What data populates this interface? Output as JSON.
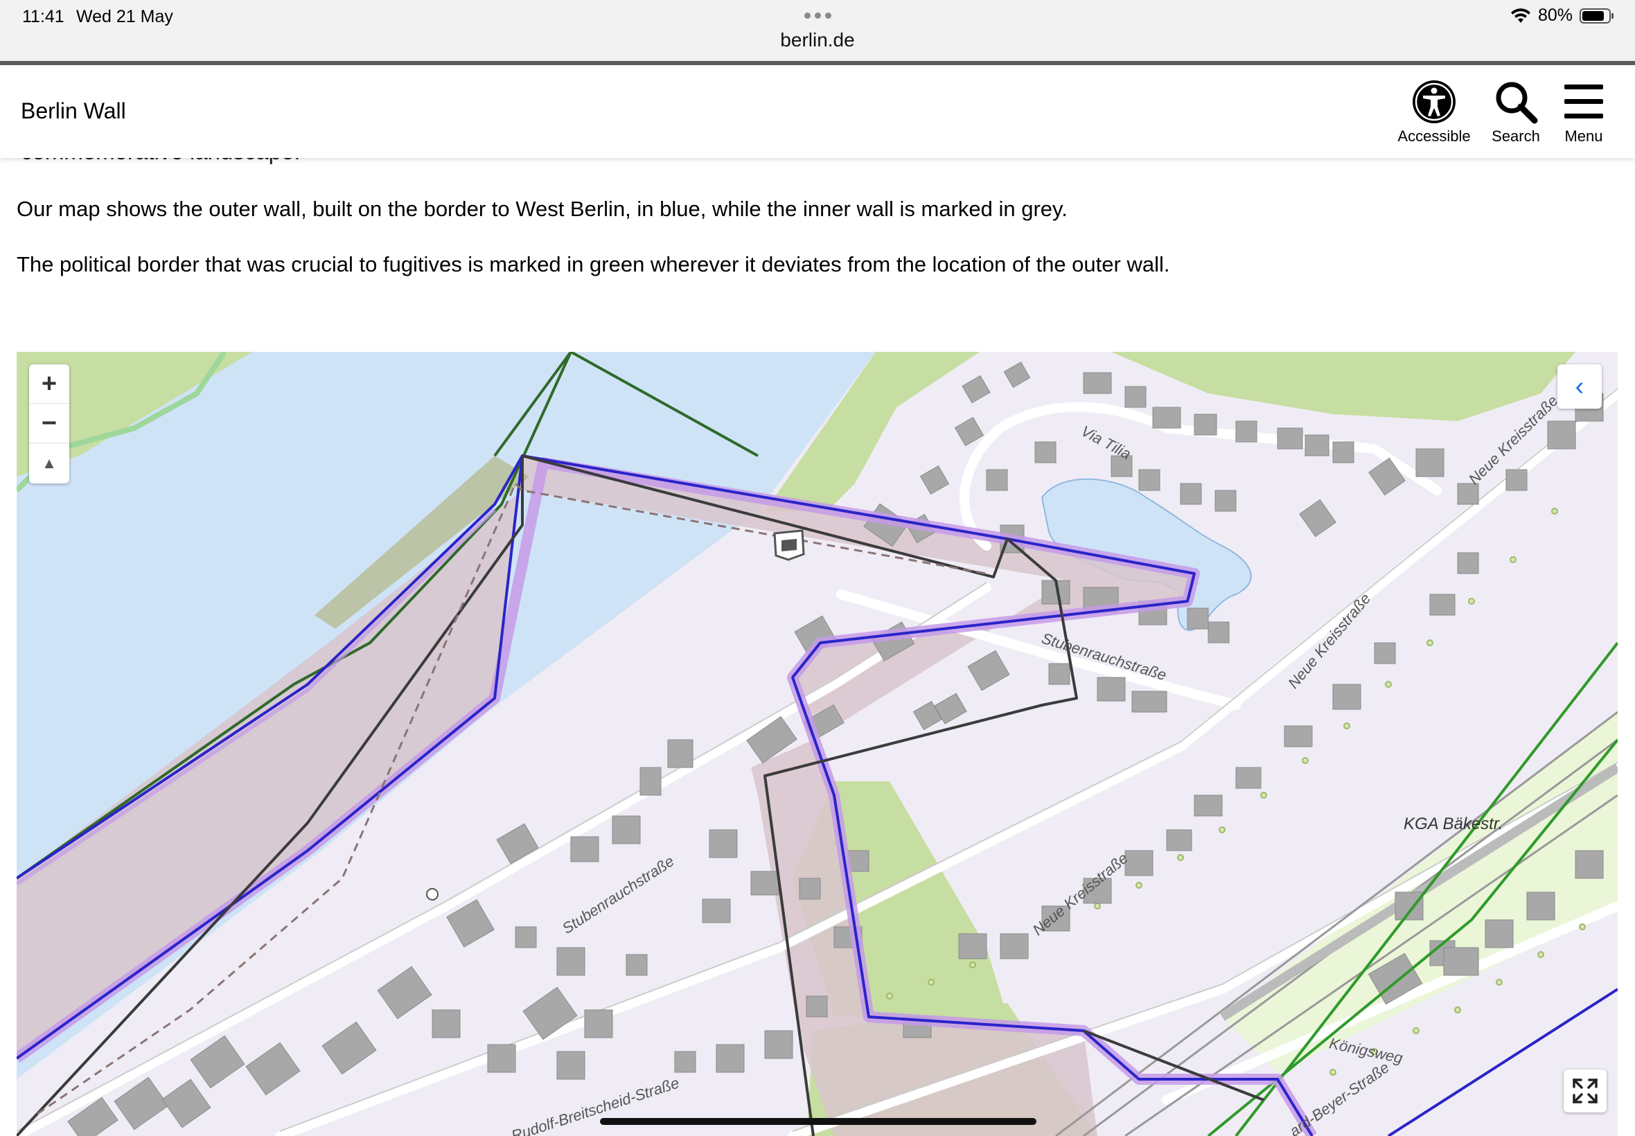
{
  "status": {
    "time": "11:41",
    "date": "Wed 21 May",
    "battery": "80%",
    "url": "berlin.de"
  },
  "header": {
    "title": "Berlin Wall",
    "accessible_label": "Accessible",
    "search_label": "Search",
    "menu_label": "Menu"
  },
  "content": {
    "clipped_text": "commemorative landscape.",
    "para1": "Our map shows the outer wall, built on the border to West Berlin, in blue, while the inner wall is marked in grey.",
    "para2": "The political border that was crucial to fugitives is marked in green wherever it deviates from the location of the outer wall."
  },
  "map": {
    "zoom_in": "+",
    "zoom_out": "−",
    "compass": "▲",
    "collapse": "‹",
    "labels": {
      "via_tilia": "Via Tilia",
      "neue_kreisstrasse_1": "Neue Kreisstraße",
      "neue_kreisstrasse_2": "Neue Kreisstraße",
      "neue_kreisstrasse_3": "Neue Kreisstraße",
      "stubenrauchstrasse_1": "Stubenrauchstraße",
      "stubenrauchstrasse_2": "Stubenrauchstraße",
      "kga": "KGA Bäkestr.",
      "koenigsweg": "Königsweg",
      "rudolf": "Rudolf-Breitscheid-Straße",
      "bernhard": "ard-Beyer-Straße"
    },
    "colors": {
      "water": "#cfe3f7",
      "land": "#f0ecf5",
      "outer_wall": "#2b24c9",
      "inner_wall": "#3b3b3b",
      "border": "#2f7a2a",
      "strip": "#d8c6cc",
      "park": "#c7dea2"
    }
  }
}
